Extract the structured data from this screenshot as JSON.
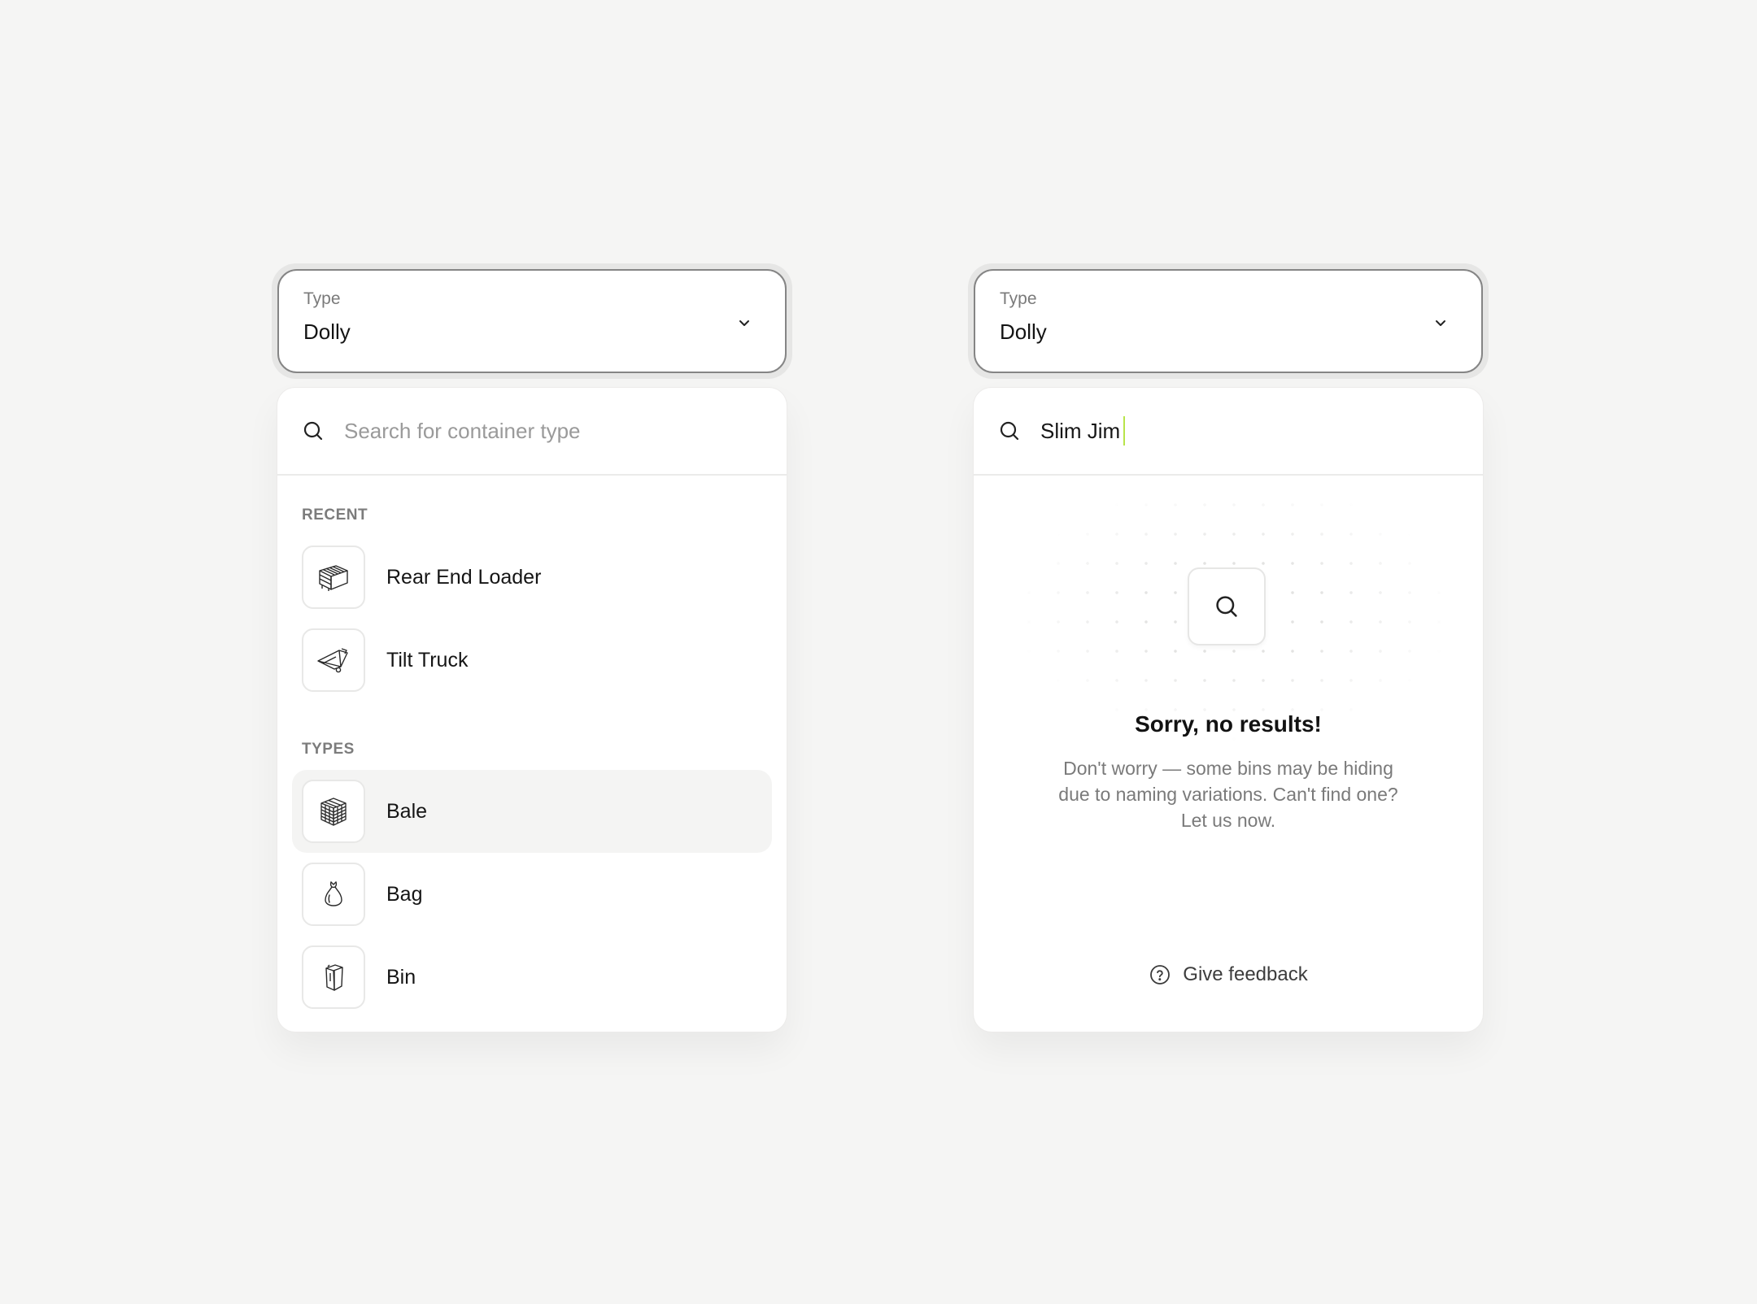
{
  "left": {
    "select": {
      "label": "Type",
      "value": "Dolly"
    },
    "search": {
      "placeholder": "Search for container type"
    },
    "recent": {
      "label": "RECENT",
      "items": [
        {
          "label": "Rear End Loader",
          "icon": "rear-end-loader-icon"
        },
        {
          "label": "Tilt Truck",
          "icon": "tilt-truck-icon"
        }
      ]
    },
    "types": {
      "label": "TYPES",
      "items": [
        {
          "label": "Bale",
          "icon": "bale-icon",
          "highlighted": true
        },
        {
          "label": "Bag",
          "icon": "bag-icon"
        },
        {
          "label": "Bin",
          "icon": "bin-icon"
        }
      ]
    }
  },
  "right": {
    "select": {
      "label": "Type",
      "value": "Dolly"
    },
    "search": {
      "value": "Slim Jim"
    },
    "empty": {
      "title": "Sorry, no results!",
      "description": "Don't worry — some bins may be hiding due to naming variations. Can't find one? Let us now."
    },
    "feedback_label": "Give feedback"
  },
  "colors": {
    "background": "#f5f5f4",
    "caret_accent": "#b8e44a",
    "hover_row": "#f4f4f3",
    "muted_text": "#7a7a7a"
  }
}
